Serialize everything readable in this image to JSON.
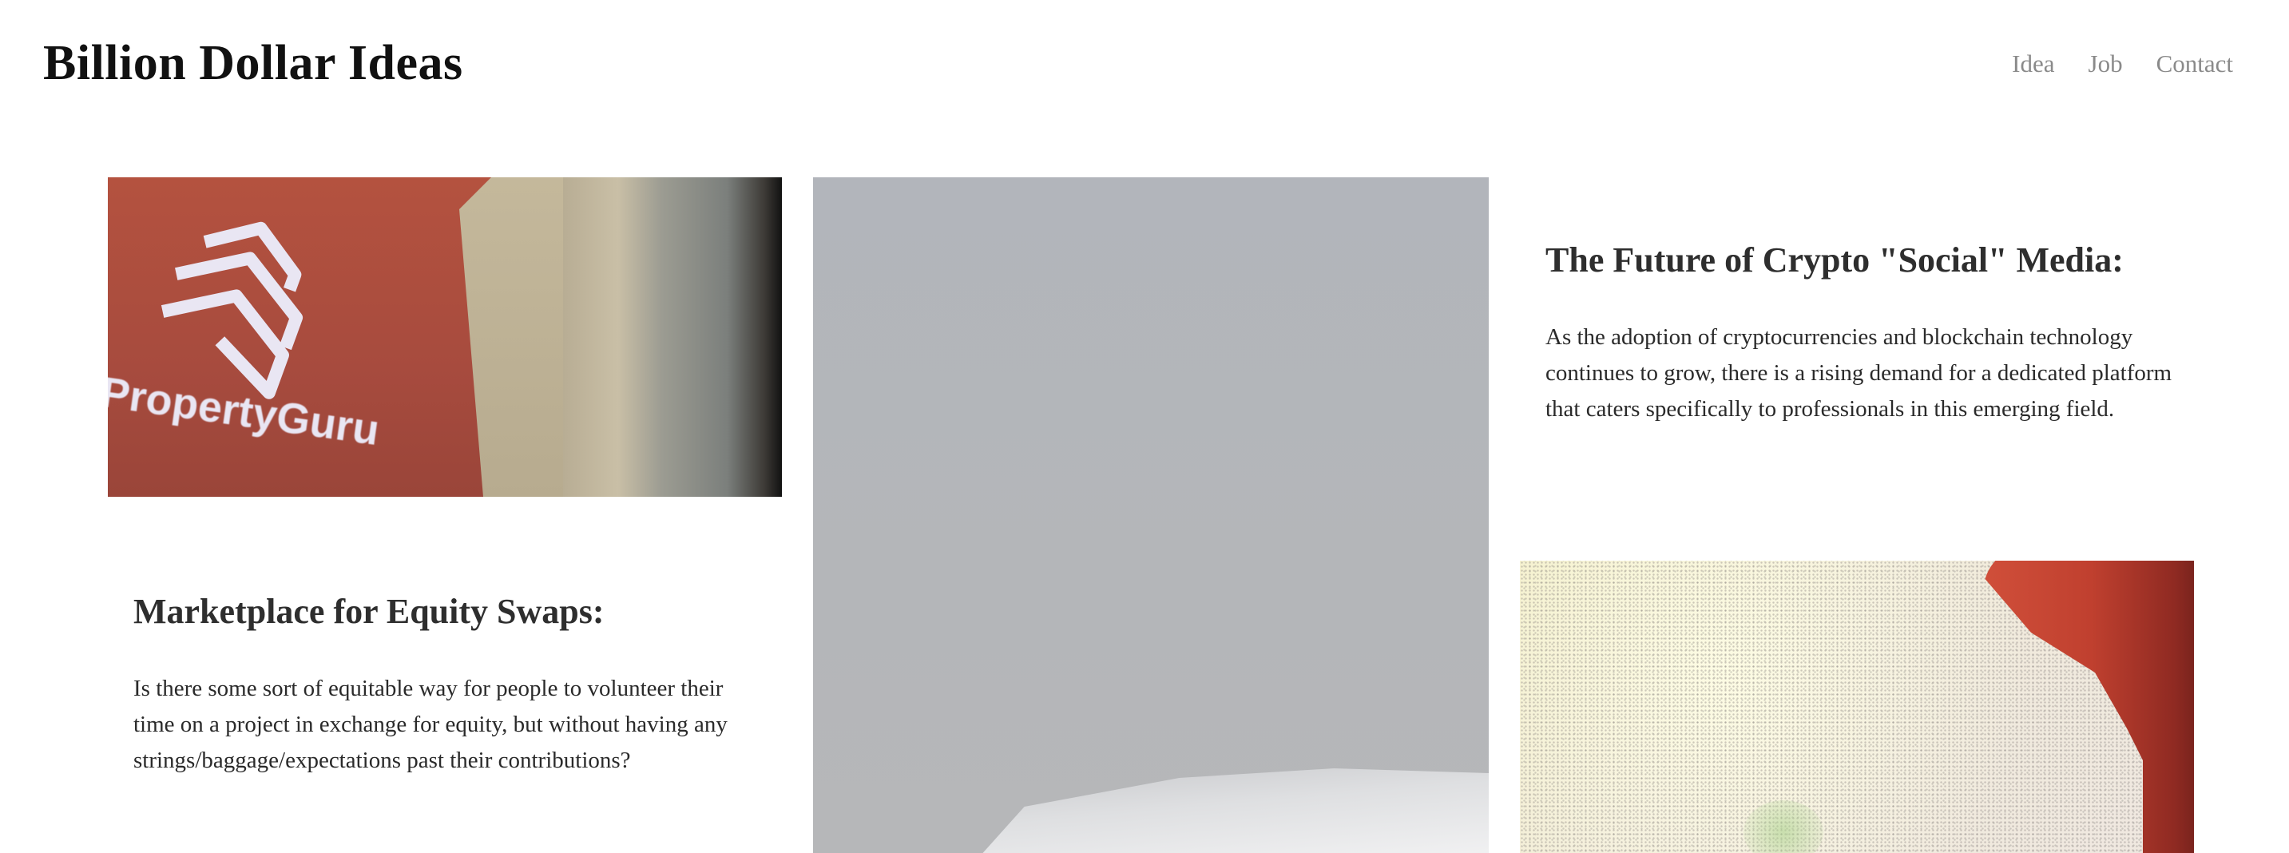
{
  "header": {
    "title": "Billion Dollar Ideas",
    "nav": [
      "Idea",
      "Job",
      "Contact"
    ]
  },
  "cards": [
    {
      "image_alt": "PropertyGuru",
      "image_text": "PropertyGuru",
      "heading": "Marketplace for Equity Swaps:",
      "body": "Is there some sort of equitable way for people to volunteer their time on a project in exchange for equity, but without having any strings/baggage/expectations past their contributions?"
    },
    {
      "image_alt": ""
    },
    {
      "heading": "The Future of Crypto \"Social\" Media:",
      "body": "As the adoption of cryptocurrencies and blockchain technology continues to grow, there is a rising demand for a dedicated platform that caters specifically to professionals in this emerging field.",
      "image_alt": ""
    }
  ],
  "colors": {
    "title": "#111111",
    "nav": "#8a8a8a",
    "text": "#2a2a2a",
    "background": "#ffffff"
  }
}
